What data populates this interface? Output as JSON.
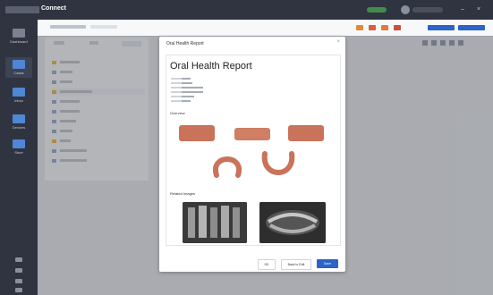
{
  "app": {
    "title": "Connect"
  },
  "sidebar": {
    "items": [
      {
        "label": "Dashboard"
      },
      {
        "label": "Cases"
      },
      {
        "label": "Inbox"
      },
      {
        "label": "Devices"
      },
      {
        "label": "Store"
      }
    ]
  },
  "modal": {
    "title": "Oral Health Report",
    "report_title": "Oral Health Report",
    "overview_label": "Overview",
    "related_images_label": "Related Images",
    "buttons": {
      "first": "OK",
      "second": "Back to Edit",
      "primary": "Save"
    }
  },
  "colors": {
    "sidebar": "#2f3440",
    "accent": "#2b63c6",
    "tooth": "#c9735a"
  },
  "icons": [
    "close-icon",
    "folder-icon",
    "file-icon",
    "grid-icon",
    "list-icon"
  ]
}
